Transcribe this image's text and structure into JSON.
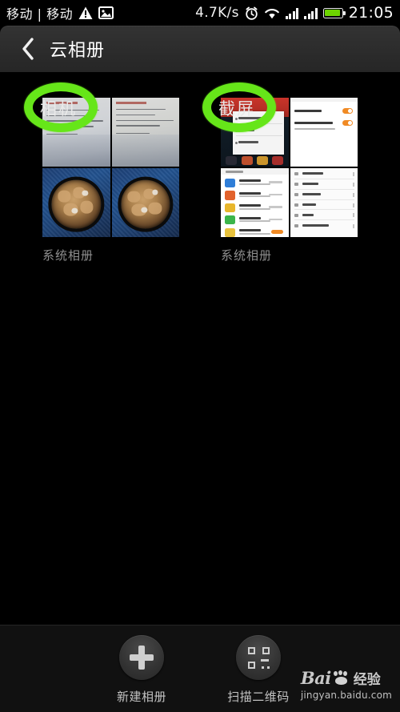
{
  "status_bar": {
    "carrier": "移动 | 移动",
    "warning_icon": "warning-triangle-icon",
    "image_icon": "image-icon",
    "network_speed": "4.7K/s",
    "alarm_icon": "alarm-clock-icon",
    "wifi_icon": "wifi-icon",
    "signal_icon_1": "signal-bars-icon",
    "signal_icon_2": "signal-bars-icon",
    "battery_icon": "battery-icon",
    "time": "21:05"
  },
  "header": {
    "back_icon": "back-chevron-icon",
    "title": "云相册"
  },
  "albums": [
    {
      "name": "相机",
      "label": "系统相册",
      "annotated": true,
      "thumbnails": [
        "document-photo",
        "document-photo",
        "food-photo",
        "food-photo"
      ]
    },
    {
      "name": "截屏",
      "label": "系统相册",
      "annotated": true,
      "thumbnails": [
        "screenshot-home",
        "screenshot-settings",
        "screenshot-app-list",
        "screenshot-menu"
      ]
    }
  ],
  "annotations": {
    "color": "#66e619",
    "shape": "ellipse",
    "items": [
      "相机",
      "截屏"
    ]
  },
  "toolbar": {
    "new_album": {
      "icon": "plus-icon",
      "label": "新建相册"
    },
    "scan_qr": {
      "icon": "qr-code-icon",
      "label": "扫描二维码"
    }
  },
  "watermark": {
    "brand": "Bai",
    "paw_icon": "paw-icon",
    "suffix": "经验",
    "url": "jingyan.baidu.com"
  }
}
